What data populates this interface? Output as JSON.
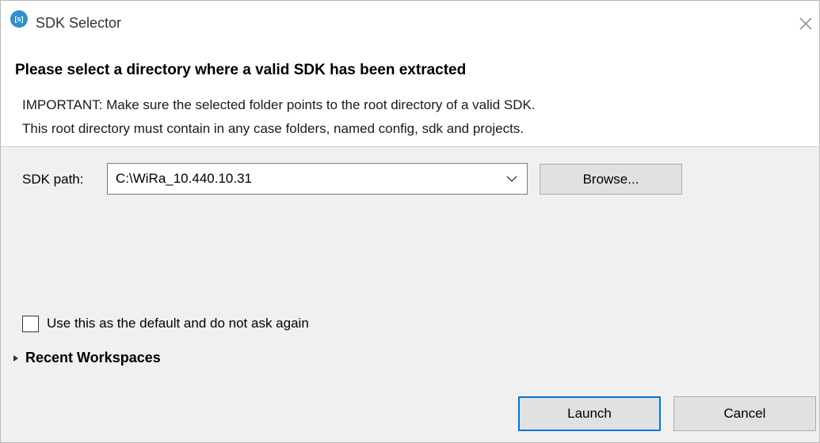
{
  "window": {
    "title": "SDK Selector",
    "app_icon_text": "[s]"
  },
  "header": {
    "heading": "Please select a directory where a valid SDK has been extracted",
    "description_line1": "IMPORTANT: Make sure the selected folder points to the root directory of a valid SDK.",
    "description_line2": "This root directory must contain in any case folders, named config, sdk and projects."
  },
  "sdk_path": {
    "label": "SDK path:",
    "value": "C:\\WiRa_10.440.10.31",
    "browse_label": "Browse..."
  },
  "default_option": {
    "label": "Use this as the default and do not ask again",
    "checked": false
  },
  "recent_workspaces": {
    "label": "Recent Workspaces",
    "expanded": false
  },
  "buttons": {
    "launch_label": "Launch",
    "cancel_label": "Cancel"
  },
  "icons": {
    "app": "app-logo-icon",
    "close": "close-icon",
    "dropdown": "chevron-down-icon",
    "expander": "triangle-right-icon"
  },
  "colors": {
    "accent": "#0078d7",
    "app_icon": "#2f8fcf"
  }
}
